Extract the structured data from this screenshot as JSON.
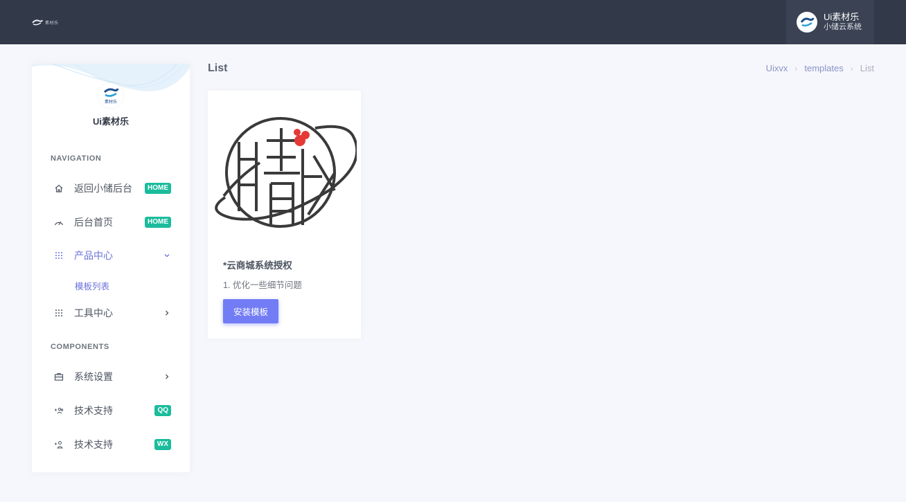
{
  "header": {
    "logo_text": "素材乐",
    "user": {
      "name": "Ui素材乐",
      "subtitle": "小储云系统"
    }
  },
  "sidebar": {
    "brand_name": "Ui素材乐",
    "brand_logo_text": "素材乐",
    "sections": [
      {
        "title": "NAVIGATION"
      },
      {
        "title": "COMPONENTS"
      }
    ],
    "items": [
      {
        "label": "返回小储后台",
        "icon": "home-icon",
        "badge": "HOME"
      },
      {
        "label": "后台首页",
        "icon": "speedometer-icon",
        "badge": "HOME"
      },
      {
        "label": "产品中心",
        "icon": "grid-icon",
        "expanded": true
      },
      {
        "label": "工具中心",
        "icon": "grid-icon"
      },
      {
        "label": "系统设置",
        "icon": "briefcase-icon"
      },
      {
        "label": "技术支持",
        "icon": "users-icon",
        "badge": "QQ"
      },
      {
        "label": "技术支持",
        "icon": "user-plus-icon",
        "badge": "WX"
      }
    ],
    "subitems": [
      {
        "label": "模板列表"
      }
    ]
  },
  "main": {
    "title": "List",
    "breadcrumb": [
      "Uixvx",
      "templates",
      "List"
    ],
    "card": {
      "title": "*云商城系统授权",
      "text": "1. 优化一些细节问题",
      "button_label": "安装模板"
    }
  },
  "colors": {
    "topbar": "#323a4a",
    "accent": "#727cf5",
    "badge": "#1abc9c",
    "active_nav": "#6b72d9"
  }
}
